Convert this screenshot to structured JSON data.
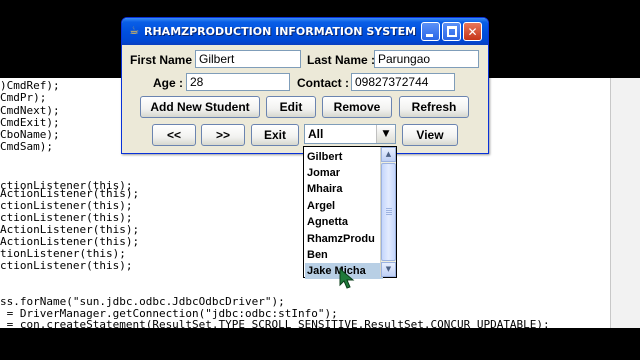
{
  "editor": {
    "lines": [
      {
        "text": ")CmdRef);"
      },
      {
        "text": "CmdPr);"
      },
      {
        "text": "CmdNext);"
      },
      {
        "text": "CmdExit);"
      },
      {
        "text": "CboName);"
      },
      {
        "text": "CmdSam);"
      },
      {
        "text": "ctionListener(this);"
      },
      {
        "text": "ActionListener(this);"
      },
      {
        "text": "ctionListener(this);"
      },
      {
        "text": "ctionListener(this);"
      },
      {
        "text": "ActionListener(this);"
      },
      {
        "text": "ActionListener(this);"
      },
      {
        "text": "tionListener(this);"
      },
      {
        "text": "ctionListener(this);"
      },
      {
        "text": "ss.forName(\"sun.jdbc.odbc.JdbcOdbcDriver\");"
      },
      {
        "text": " = DriverManager.getConnection(\"jdbc:odbc:stInfo\");"
      },
      {
        "text": " = con.createStatement(ResultSet.TYPE_SCROLL_SENSITIVE,ResultSet.CONCUR_UPDATABLE);"
      }
    ]
  },
  "window": {
    "title": "RHAMZPRODUCTION INFORMATION SYSTEM",
    "title_bar_color": "#0050de",
    "controls": {
      "minimize_icon": "minimize-icon",
      "maximize_icon": "maximize-icon",
      "close_icon": "close-icon"
    }
  },
  "form": {
    "first_name_label": "First Name :",
    "first_name_value": "Gilbert",
    "last_name_label": "Last Name :",
    "last_name_value": "Parungao",
    "age_label": "Age :",
    "age_value": "28",
    "contact_label": "Contact :",
    "contact_value": "09827372744"
  },
  "buttons": {
    "add": "Add New Student",
    "edit": "Edit",
    "remove": "Remove",
    "refresh": "Refresh",
    "prev": "<<",
    "next": ">>",
    "exit": "Exit",
    "view": "View"
  },
  "combo": {
    "selected": "All",
    "options": [
      "Gilbert",
      "Jomar",
      "Mhaira",
      "Argel",
      "Agnetta",
      "RhamzProdu",
      "Ben",
      "Jake Micha"
    ],
    "highlighted": "Jake Micha"
  }
}
